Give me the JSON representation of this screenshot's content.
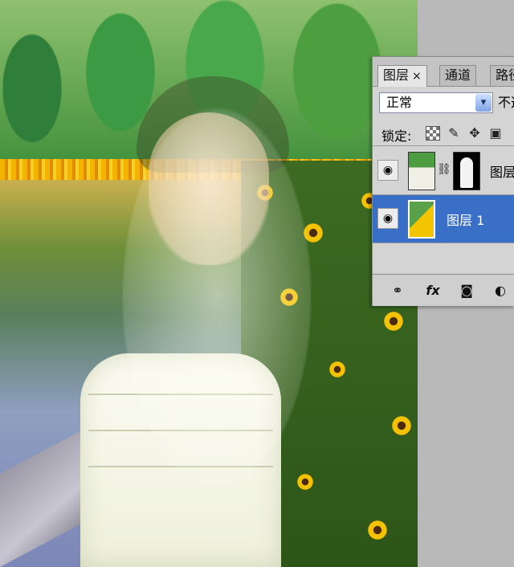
{
  "layers_panel": {
    "tabs": [
      {
        "label": "图层",
        "close": "×",
        "active": true
      },
      {
        "label": "通道",
        "active": false
      },
      {
        "label": "路径",
        "active": false
      }
    ],
    "blend_mode": "正常",
    "opacity_label": "不透明度",
    "lock_label": "锁定:",
    "layers": [
      {
        "name": "图层",
        "visible": true,
        "has_mask": true,
        "selected": false
      },
      {
        "name": "图层 1",
        "visible": true,
        "has_mask": false,
        "selected": true
      }
    ],
    "bottom_icons": [
      "link-icon",
      "fx-icon",
      "mask-icon",
      "adjustment-icon"
    ],
    "fx_label": "fx"
  },
  "colors": {
    "selected_layer": "#3a6fc7",
    "panel_bg": "#d4d4d4"
  }
}
